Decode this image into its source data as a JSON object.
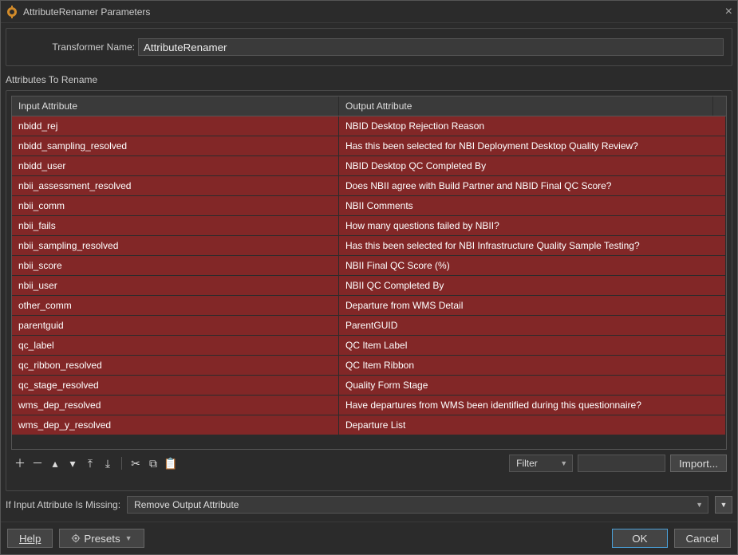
{
  "window": {
    "title": "AttributeRenamer Parameters"
  },
  "transformer": {
    "label": "Transformer Name:",
    "value": "AttributeRenamer"
  },
  "section": {
    "attributes_label": "Attributes To Rename"
  },
  "table": {
    "headers": {
      "input": "Input Attribute",
      "output": "Output Attribute"
    },
    "rows": [
      {
        "input": "nbidd_rej",
        "output": "NBID Desktop Rejection Reason"
      },
      {
        "input": "nbidd_sampling_resolved",
        "output": "Has this been selected for NBI Deployment Desktop Quality Review?"
      },
      {
        "input": "nbidd_user",
        "output": "NBID Desktop QC Completed By"
      },
      {
        "input": "nbii_assessment_resolved",
        "output": "Does NBII agree with Build Partner and NBID Final QC Score?"
      },
      {
        "input": "nbii_comm",
        "output": "NBII Comments"
      },
      {
        "input": "nbii_fails",
        "output": "How many questions failed by NBII?"
      },
      {
        "input": "nbii_sampling_resolved",
        "output": "Has this been selected for NBI Infrastructure Quality Sample Testing?"
      },
      {
        "input": "nbii_score",
        "output": "NBII Final QC Score (%)"
      },
      {
        "input": "nbii_user",
        "output": "NBII QC Completed By"
      },
      {
        "input": "other_comm",
        "output": "Departure from WMS Detail"
      },
      {
        "input": "parentguid",
        "output": "ParentGUID"
      },
      {
        "input": "qc_label",
        "output": "QC Item Label"
      },
      {
        "input": "qc_ribbon_resolved",
        "output": "QC Item Ribbon"
      },
      {
        "input": "qc_stage_resolved",
        "output": "Quality Form Stage"
      },
      {
        "input": "wms_dep_resolved",
        "output": "Have departures from WMS been identified during this questionnaire?"
      },
      {
        "input": "wms_dep_y_resolved",
        "output": "Departure List"
      }
    ]
  },
  "toolbar": {
    "filter_label": "Filter",
    "import_label": "Import..."
  },
  "missing": {
    "label": "If Input Attribute Is Missing:",
    "value": "Remove Output Attribute"
  },
  "footer": {
    "help": "Help",
    "presets": "Presets",
    "ok": "OK",
    "cancel": "Cancel"
  }
}
